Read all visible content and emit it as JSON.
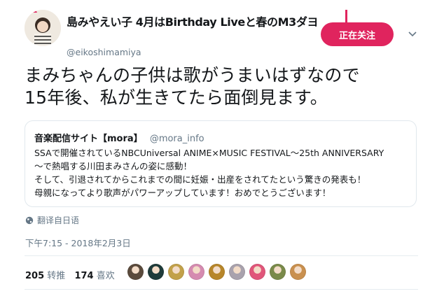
{
  "tweet": {
    "display_name": "島みやえい子 4月はBirthday Liveと春のM3ダヨ",
    "handle": "@eikoshimamiya",
    "follow_button": "正在关注",
    "text_lines": [
      "まみちゃんの子供は歌がうまいはずなので",
      "15年後、私が生きてたら面倒見ます。"
    ],
    "translate_label": "翻译自日语",
    "timestamp": "下午7:15 - 2018年2月3日"
  },
  "quote": {
    "name": "音楽配信サイト【mora】",
    "handle": "@mora_info",
    "lines": [
      "SSAで開催されているNBCUniversal  ANIME×MUSIC  FESTIVAL～25th ANNIVERSARY",
      "～で熱唱する川田まみさんの姿に感動！",
      "そして、引退されてからこれまでの間に妊娠・出産をされてたという驚きの発表も！",
      "母親になってより歌声がパワーアップしています！おめでとうございます！"
    ]
  },
  "stats": {
    "retweets_count": "205",
    "retweets_label": "转推",
    "likes_count": "174",
    "likes_label": "喜欢"
  },
  "likers": [
    {
      "name": "liker-avatar-1",
      "color": "#5a4a3c"
    },
    {
      "name": "liker-avatar-2",
      "color": "#1f3b3a"
    },
    {
      "name": "liker-avatar-3",
      "color": "#c2a14a"
    },
    {
      "name": "liker-avatar-4",
      "color": "#d58bb0"
    },
    {
      "name": "liker-avatar-5",
      "color": "#b7862a"
    },
    {
      "name": "liker-avatar-6",
      "color": "#a9a2ad"
    },
    {
      "name": "liker-avatar-7",
      "color": "#e0567a"
    },
    {
      "name": "liker-avatar-8",
      "color": "#7a8a4a"
    },
    {
      "name": "liker-avatar-9",
      "color": "#c9904f"
    }
  ],
  "colors": {
    "accent": "#e0245e",
    "secondary_text": "#657786",
    "border": "#e1e8ed"
  }
}
